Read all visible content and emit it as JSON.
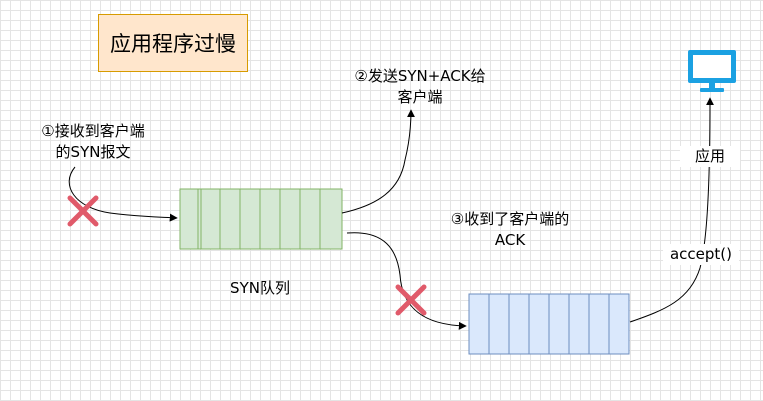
{
  "title": "应用程序过慢",
  "labels": {
    "step1_line1": "①接收到客户端",
    "step1_line2": "的SYN报文",
    "step2_line1": "②发送SYN+ACK给",
    "step2_line2": "客户端",
    "step3_line1": "③收到了客户端的",
    "step3_line2": "ACK",
    "syn_queue": "SYN队列",
    "app": "应用",
    "accept": "accept()"
  },
  "icons": {
    "monitor": "monitor-icon",
    "drop": "x-mark-icon"
  },
  "colors": {
    "title_fill": "#ffe6cc",
    "title_stroke": "#d79b00",
    "syn_fill": "#d5e8d4",
    "syn_stroke": "#82b366",
    "accept_fill": "#dae8fc",
    "accept_stroke": "#6c8ebf",
    "x_mark": "#e05a6a",
    "monitor": "#1ba1e2"
  }
}
